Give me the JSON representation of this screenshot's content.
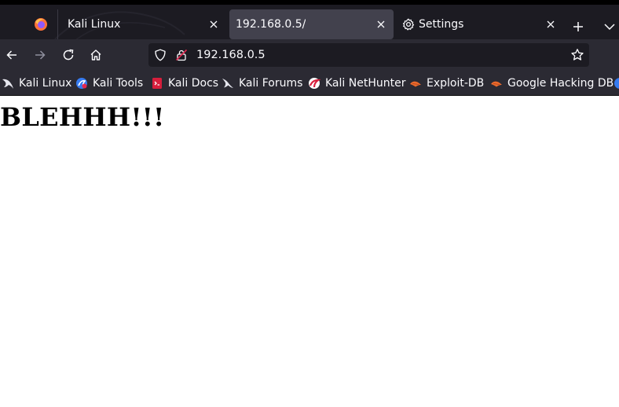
{
  "browser": {
    "tabs": [
      {
        "label": "Kali Linux",
        "active": false
      },
      {
        "label": "192.168.0.5/",
        "active": true
      },
      {
        "label": "Settings",
        "active": false
      }
    ],
    "url": "192.168.0.5",
    "icons": {
      "firefox": "firefox-icon",
      "close": "close-icon",
      "new_tab": "plus-icon",
      "list_tabs": "chevron-down-icon",
      "back": "back-arrow-icon",
      "forward": "forward-arrow-icon",
      "reload": "reload-icon",
      "home": "home-icon",
      "shield": "shield-icon",
      "insecure": "insecure-lock-icon",
      "bookmark_star": "star-icon",
      "settings": "gear-icon"
    }
  },
  "bookmarks": [
    {
      "label": "Kali Linux",
      "icon": "kali-dragon-icon"
    },
    {
      "label": "Kali Tools",
      "icon": "kali-tools-icon"
    },
    {
      "label": "Kali Docs",
      "icon": "kali-docs-icon"
    },
    {
      "label": "Kali Forums",
      "icon": "kali-forums-icon"
    },
    {
      "label": "Kali NetHunter",
      "icon": "nethunter-icon"
    },
    {
      "label": "Exploit-DB",
      "icon": "exploit-db-icon"
    },
    {
      "label": "Google Hacking DB",
      "icon": "ghdb-icon"
    }
  ],
  "page": {
    "heading": "BLEHHH!!!"
  },
  "colors": {
    "tab_strip": "#1c1b22",
    "toolbar": "#2b2a33",
    "active_tab": "#42414d",
    "url_field": "#1c1b22",
    "text_light": "#fbfbfe",
    "page_bg": "#ffffff"
  }
}
